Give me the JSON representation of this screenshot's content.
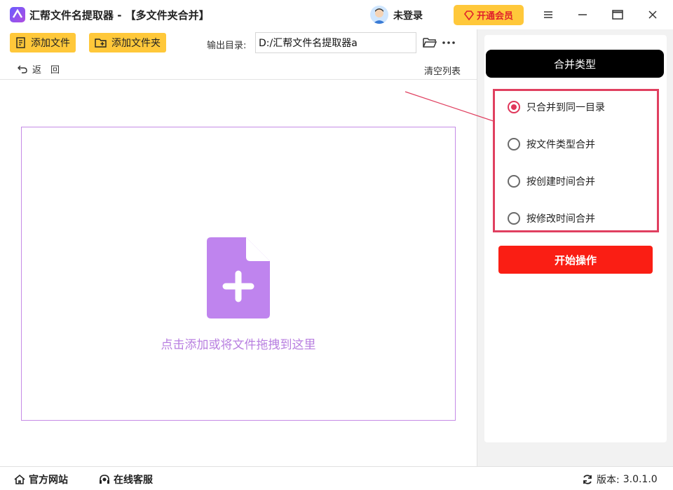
{
  "titlebar": {
    "title": "汇帮文件名提取器 - 【多文件夹合并】",
    "user_label": "未登录",
    "vip_label": "开通会员"
  },
  "toolbar": {
    "add_file_label": "添加文件",
    "add_folder_label": "添加文件夹",
    "output_label": "输出目录:",
    "output_value": "D:/汇帮文件名提取器a",
    "back_label": "返　回",
    "clear_label": "清空列表"
  },
  "dropzone": {
    "hint": "点击添加或将文件拖拽到这里"
  },
  "merge": {
    "header": "合并类型",
    "options": [
      {
        "label": "只合并到同一目录",
        "checked": true
      },
      {
        "label": "按文件类型合并",
        "checked": false
      },
      {
        "label": "按创建时间合并",
        "checked": false
      },
      {
        "label": "按修改时间合并",
        "checked": false
      }
    ],
    "start_label": "开始操作"
  },
  "footer": {
    "website_label": "官方网站",
    "support_label": "在线客服",
    "version_prefix": "版本:",
    "version": "3.0.1.0"
  },
  "colors": {
    "accent_yellow": "#ffc83a",
    "start_red": "#fa1e14",
    "highlight_red": "#e04060",
    "drop_purple": "#b87fe0"
  }
}
